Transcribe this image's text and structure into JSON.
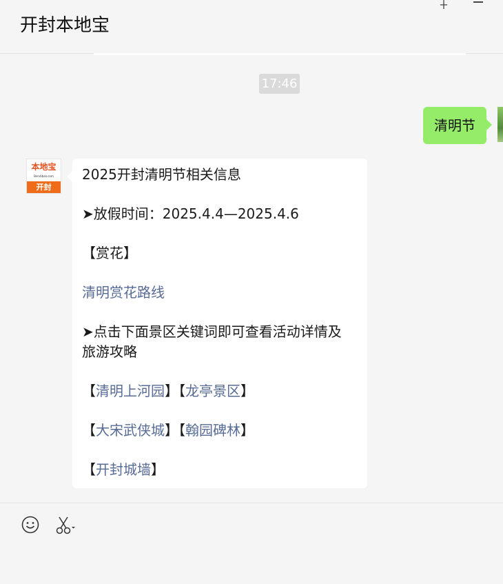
{
  "window": {
    "title": "开封本地宝"
  },
  "chat": {
    "timestamp": "17:46",
    "my_message": "清明节",
    "reply": {
      "title": "2025开封清明节相关信息",
      "holiday": "➤放假时间：2025.4.4—2025.4.6",
      "section_flower": "【赏花】",
      "flower_route_link": "清明赏花路线",
      "tip_line1": "➤点击下面景区关键词即可查看活动详情及",
      "tip_line2": "旅游攻略",
      "bracket_open": "【",
      "bracket_close": "】",
      "links": {
        "qingming_garden": "清明上河园",
        "longting": "龙亭景区",
        "dasong": "大宋武侠城",
        "hanyuan": "翰园碑林",
        "city_wall": "开封城墙"
      }
    }
  },
  "avatar": {
    "top_text": "本地宝",
    "sub_text": "Bendibao.com",
    "bottom_text": "开封"
  },
  "toolbar": {
    "icons": [
      "emoji-icon",
      "scissors-icon"
    ]
  },
  "colors": {
    "background": "#f5f5f5",
    "my_bubble": "#95ec69",
    "link": "#576b95",
    "avatar_orange": "#ef6c1a"
  }
}
